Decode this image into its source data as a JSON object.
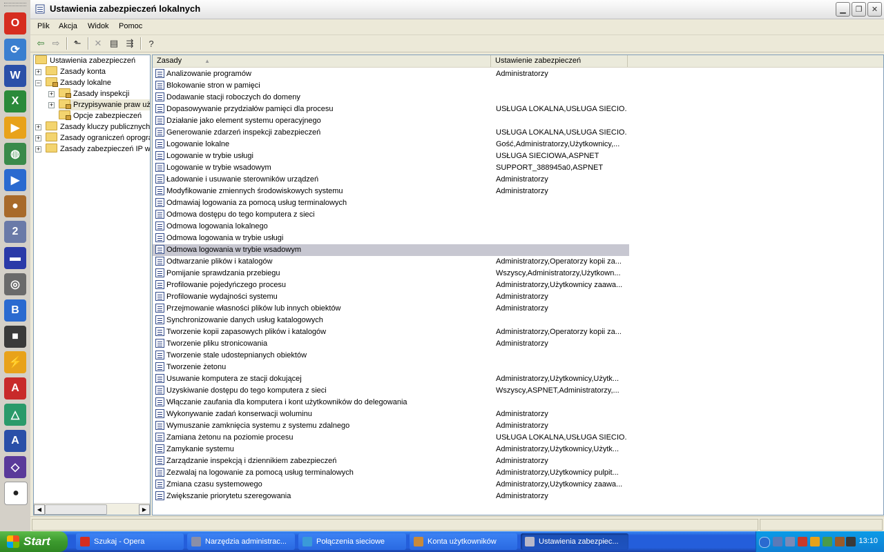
{
  "window": {
    "title": "Ustawienia zabezpieczeń lokalnych"
  },
  "menu": [
    "Plik",
    "Akcja",
    "Widok",
    "Pomoc"
  ],
  "tree": {
    "root": "Ustawienia zabezpieczeń",
    "nodes": [
      {
        "label": "Zasady konta",
        "expander": "+"
      },
      {
        "label": "Zasady lokalne",
        "expander": "−"
      },
      {
        "label": "Zasady inspekcji",
        "expander": "+"
      },
      {
        "label": "Przypisywanie praw uż",
        "expander": "+"
      },
      {
        "label": "Opcje zabezpieczeń",
        "expander": ""
      },
      {
        "label": "Zasady kluczy publicznych",
        "expander": "+"
      },
      {
        "label": "Zasady ograniczeń oprogra",
        "expander": "+"
      },
      {
        "label": "Zasady zabezpieczeń IP w",
        "expander": "+"
      }
    ]
  },
  "list": {
    "columns": [
      "Zasady",
      "Ustawienie zabezpieczeń"
    ],
    "rows": [
      {
        "name": "Analizowanie programów",
        "value": "Administratorzy"
      },
      {
        "name": "Blokowanie stron w pamięci",
        "value": ""
      },
      {
        "name": "Dodawanie stacji roboczych do domeny",
        "value": ""
      },
      {
        "name": "Dopasowywanie przydziałów pamięci dla procesu",
        "value": "USŁUGA LOKALNA,USŁUGA SIECIO..."
      },
      {
        "name": "Działanie jako element systemu operacyjnego",
        "value": ""
      },
      {
        "name": "Generowanie zdarzeń inspekcji zabezpieczeń",
        "value": "USŁUGA LOKALNA,USŁUGA SIECIO..."
      },
      {
        "name": "Logowanie lokalne",
        "value": "Gość,Administratorzy,Użytkownicy,..."
      },
      {
        "name": "Logowanie w trybie usługi",
        "value": "USŁUGA SIECIOWA,ASPNET"
      },
      {
        "name": "Logowanie w trybie wsadowym",
        "value": "SUPPORT_388945a0,ASPNET"
      },
      {
        "name": "Ładowanie i usuwanie sterowników urządzeń",
        "value": "Administratorzy"
      },
      {
        "name": "Modyfikowanie zmiennych środowiskowych systemu",
        "value": "Administratorzy"
      },
      {
        "name": "Odmawiaj logowania za pomocą usług terminalowych",
        "value": ""
      },
      {
        "name": "Odmowa dostępu do tego komputera z sieci",
        "value": ""
      },
      {
        "name": "Odmowa logowania lokalnego",
        "value": ""
      },
      {
        "name": "Odmowa logowania w trybie usługi",
        "value": ""
      },
      {
        "name": "Odmowa logowania w trybie wsadowym",
        "value": "",
        "selected": true
      },
      {
        "name": "Odtwarzanie plików i katalogów",
        "value": "Administratorzy,Operatorzy kopii za..."
      },
      {
        "name": "Pomijanie sprawdzania przebiegu",
        "value": "Wszyscy,Administratorzy,Użytkown..."
      },
      {
        "name": "Profilowanie pojedyńczego procesu",
        "value": "Administratorzy,Użytkownicy zaawa..."
      },
      {
        "name": "Profilowanie wydajności systemu",
        "value": "Administratorzy"
      },
      {
        "name": "Przejmowanie własności plików lub innych obiektów",
        "value": "Administratorzy"
      },
      {
        "name": "Synchronizowanie danych usług katalogowych",
        "value": ""
      },
      {
        "name": "Tworzenie kopii zapasowych plików i katalogów",
        "value": "Administratorzy,Operatorzy kopii za..."
      },
      {
        "name": "Tworzenie pliku stronicowania",
        "value": "Administratorzy"
      },
      {
        "name": "Tworzenie stale udostepnianych obiektów",
        "value": ""
      },
      {
        "name": "Tworzenie żetonu",
        "value": ""
      },
      {
        "name": "Usuwanie komputera ze stacji dokującej",
        "value": "Administratorzy,Użytkownicy,Użytk..."
      },
      {
        "name": "Uzyskiwanie dostępu do tego komputera z sieci",
        "value": "Wszyscy,ASPNET,Administratorzy,..."
      },
      {
        "name": "Włączanie zaufania dla komputera i kont użytkowników do delegowania",
        "value": ""
      },
      {
        "name": "Wykonywanie zadań konserwacji woluminu",
        "value": "Administratorzy"
      },
      {
        "name": "Wymuszanie zamknięcia systemu z systemu zdalnego",
        "value": "Administratorzy"
      },
      {
        "name": "Zamiana żetonu na poziomie procesu",
        "value": "USŁUGA LOKALNA,USŁUGA SIECIO..."
      },
      {
        "name": "Zamykanie systemu",
        "value": "Administratorzy,Użytkownicy,Użytk..."
      },
      {
        "name": "Zarządzanie inspekcją i dziennikiem zabezpieczeń",
        "value": "Administratorzy"
      },
      {
        "name": "Zezwalaj na logowanie za pomocą usług terminalowych",
        "value": "Administratorzy,Użytkownicy pulpit..."
      },
      {
        "name": "Zmiana czasu systemowego",
        "value": "Administratorzy,Użytkownicy zaawa..."
      },
      {
        "name": "Zwiększanie priorytetu szeregowania",
        "value": "Administratorzy"
      }
    ]
  },
  "taskbar": {
    "start_label": "Start",
    "tasks": [
      {
        "label": "Szukaj - Opera",
        "icon_color": "#d62d20"
      },
      {
        "label": "Narzędzia administrac...",
        "icon_color": "#8a8fa8"
      },
      {
        "label": "Połączenia sieciowe",
        "icon_color": "#3a9ad9"
      },
      {
        "label": "Konta użytkowników",
        "icon_color": "#c98a3a"
      },
      {
        "label": "Ustawienia zabezpiec...",
        "icon_color": "#b8b8c8",
        "active": true
      }
    ],
    "clock": "13:10"
  },
  "launcher_icons": [
    {
      "name": "opera-icon",
      "color": "#d62d20",
      "glyph": "O"
    },
    {
      "name": "sync-icon",
      "color": "#3a7fd0",
      "glyph": "⟳"
    },
    {
      "name": "word-icon",
      "color": "#2a4fa8",
      "glyph": "W"
    },
    {
      "name": "excel-icon",
      "color": "#2a8a3a",
      "glyph": "X"
    },
    {
      "name": "media-skip-icon",
      "color": "#e8a21a",
      "glyph": "▶"
    },
    {
      "name": "globe-icon",
      "color": "#3a8a4a",
      "glyph": "◍"
    },
    {
      "name": "media-player-icon",
      "color": "#2a6ad0",
      "glyph": "▶"
    },
    {
      "name": "emule-icon",
      "color": "#a86a2a",
      "glyph": "●"
    },
    {
      "name": "opm-icon",
      "color": "#6a7aa8",
      "glyph": "2"
    },
    {
      "name": "floppy-icon",
      "color": "#2a3aa8",
      "glyph": "▬"
    },
    {
      "name": "film-icon",
      "color": "#6a6a6a",
      "glyph": "◎"
    },
    {
      "name": "bs-icon",
      "color": "#2a6ad0",
      "glyph": "B"
    },
    {
      "name": "camera-icon",
      "color": "#3a3a3a",
      "glyph": "■"
    },
    {
      "name": "lightning-icon",
      "color": "#e8a21a",
      "glyph": "⚡"
    },
    {
      "name": "acrobat-icon",
      "color": "#c82a2a",
      "glyph": "A"
    },
    {
      "name": "graph-icon",
      "color": "#2a9a6a",
      "glyph": "△"
    },
    {
      "name": "az-icon",
      "color": "#2a4fa8",
      "glyph": "A"
    },
    {
      "name": "binary-icon",
      "color": "#5a3a9a",
      "glyph": "◇"
    },
    {
      "name": "panda-icon",
      "color": "#ffffff",
      "glyph": "●"
    }
  ]
}
